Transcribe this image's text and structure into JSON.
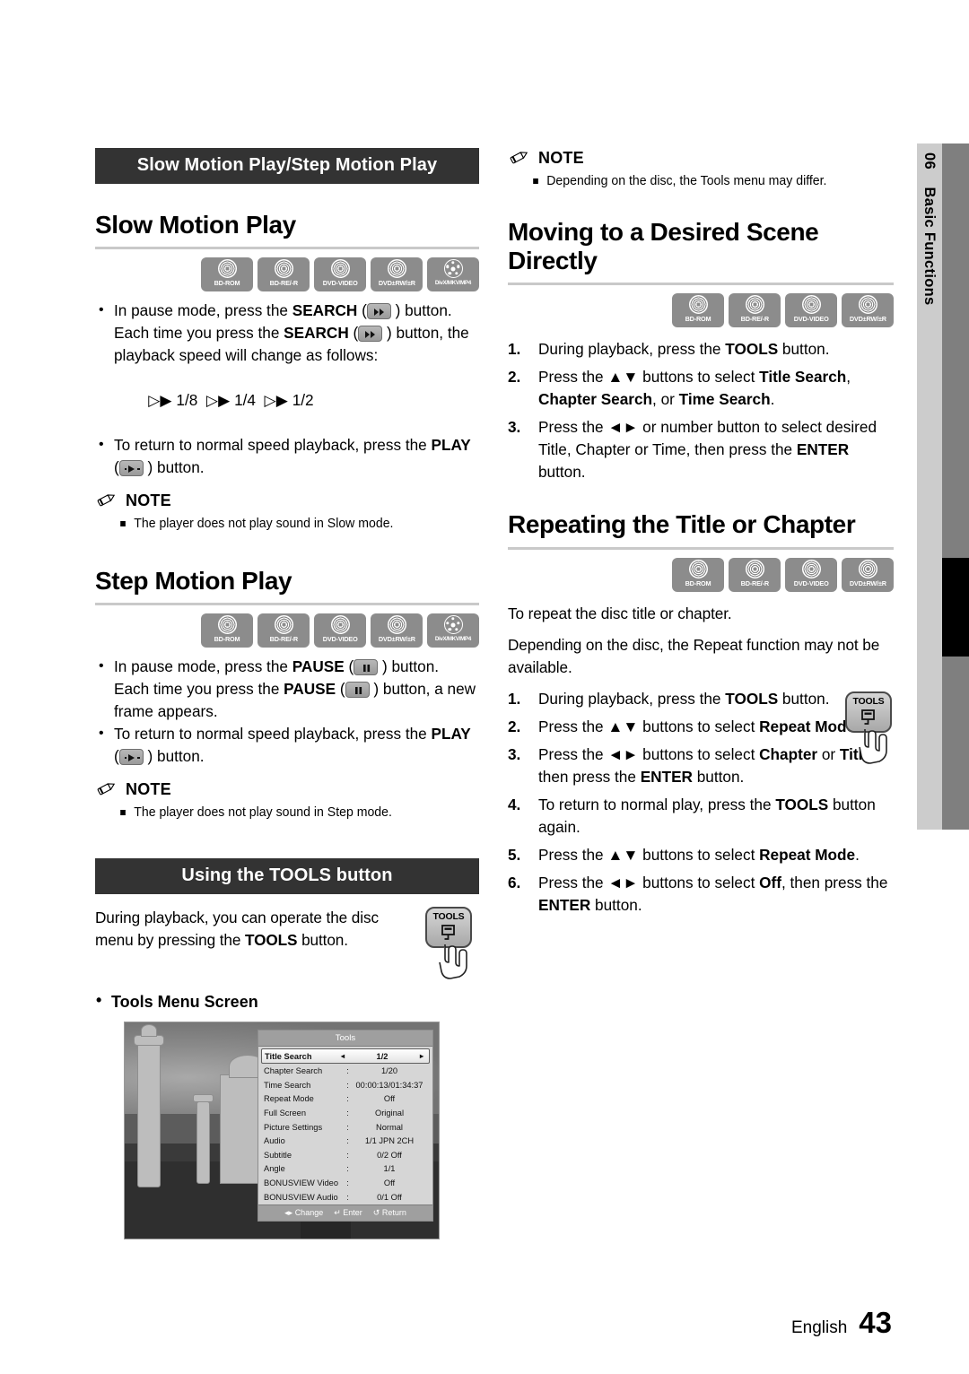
{
  "page": {
    "chapter_number": "06",
    "chapter_title": "Basic Functions",
    "footer_language": "English",
    "footer_page": "43"
  },
  "left_column": {
    "section_bar_1": "Slow Motion Play/Step Motion Play",
    "heading_slow": "Slow Motion Play",
    "discs_slow": [
      {
        "label": "BD-ROM",
        "type": "disc"
      },
      {
        "label": "BD-RE/-R",
        "type": "disc"
      },
      {
        "label": "DVD-VIDEO",
        "type": "disc"
      },
      {
        "label": "DVD±RW/±R",
        "type": "disc"
      },
      {
        "label": "DivX/MKV/MP4",
        "type": "divx"
      }
    ],
    "slow_bullet_1_a": "In pause mode, press the ",
    "slow_bullet_1_search": "SEARCH",
    "slow_bullet_1_b": " ) button.",
    "slow_cont_a": "Each time you press the ",
    "slow_cont_search": "SEARCH",
    "slow_cont_b": " ) button, the playback speed will change as follows:",
    "slow_speeds": "1/8      1/4      1/2",
    "slow_bullet_2_a": "To return to normal speed playback, press the ",
    "slow_bullet_2_play": "PLAY",
    "slow_bullet_2_b": " ) button.",
    "note_label_1": "NOTE",
    "note_items_1": [
      "The player does not play sound in Slow mode."
    ],
    "heading_step": "Step Motion Play",
    "discs_step": [
      {
        "label": "BD-ROM",
        "type": "disc"
      },
      {
        "label": "BD-RE/-R",
        "type": "disc"
      },
      {
        "label": "DVD-VIDEO",
        "type": "disc"
      },
      {
        "label": "DVD±RW/±R",
        "type": "disc"
      },
      {
        "label": "DivX/MKV/MP4",
        "type": "divx"
      }
    ],
    "step_bullet_1_a": "In pause mode, press the ",
    "step_bullet_1_pause": "PAUSE",
    "step_bullet_1_b": " ) button.",
    "step_cont_a": "Each time you press the ",
    "step_cont_pause": "PAUSE",
    "step_cont_b": " ) button, a new frame appears.",
    "step_bullet_2_a": "To return to normal speed playback, press the ",
    "step_bullet_2_play": "PLAY",
    "step_bullet_2_b": " ) button.",
    "note_label_2": "NOTE",
    "note_items_2": [
      "The player does not play sound in Step mode."
    ],
    "section_bar_2": "Using the TOOLS button",
    "tools_intro_a": "During playback, you can operate the disc menu by pressing the ",
    "tools_intro_tools": "TOOLS",
    "tools_intro_b": " button.",
    "tools_key_label": "TOOLS",
    "tools_menu_screen_label": "Tools Menu Screen"
  },
  "tools_menu": {
    "title": "Tools",
    "rows": [
      {
        "label": "Title Search",
        "colon": "",
        "value": "1/2",
        "selected": true
      },
      {
        "label": "Chapter Search",
        "colon": ":",
        "value": "1/20",
        "selected": false
      },
      {
        "label": "Time Search",
        "colon": ":",
        "value": "00:00:13/01:34:37",
        "selected": false
      },
      {
        "label": "Repeat Mode",
        "colon": ":",
        "value": "Off",
        "selected": false
      },
      {
        "label": "Full Screen",
        "colon": ":",
        "value": "Original",
        "selected": false
      },
      {
        "label": "Picture Settings",
        "colon": ":",
        "value": "Normal",
        "selected": false
      },
      {
        "label": "Audio",
        "colon": ":",
        "value": "1/1 JPN 2CH",
        "selected": false
      },
      {
        "label": "Subtitle",
        "colon": ":",
        "value": "0/2 Off",
        "selected": false
      },
      {
        "label": "Angle",
        "colon": ":",
        "value": "1/1",
        "selected": false
      },
      {
        "label": "BONUSVIEW Video",
        "colon": ":",
        "value": "Off",
        "selected": false
      },
      {
        "label": "BONUSVIEW Audio",
        "colon": ":",
        "value": "0/1 Off",
        "selected": false
      }
    ],
    "footer": [
      {
        "icon": "◂▸",
        "label": "Change"
      },
      {
        "icon": "↵",
        "label": "Enter"
      },
      {
        "icon": "↺",
        "label": "Return"
      }
    ]
  },
  "right_column": {
    "note_label_top": "NOTE",
    "note_items_top": [
      "Depending on the disc, the Tools menu may differ."
    ],
    "heading_moving": "Moving to a Desired Scene Directly",
    "discs_moving": [
      {
        "label": "BD-ROM",
        "type": "disc"
      },
      {
        "label": "BD-RE/-R",
        "type": "disc"
      },
      {
        "label": "DVD-VIDEO",
        "type": "disc"
      },
      {
        "label": "DVD±RW/±R",
        "type": "disc"
      }
    ],
    "moving_steps": [
      {
        "n": "1.",
        "parts": [
          {
            "t": "During playback, press the ",
            "b": false
          },
          {
            "t": "TOOLS",
            "b": true
          },
          {
            "t": " button.",
            "b": false
          }
        ]
      },
      {
        "n": "2.",
        "parts": [
          {
            "t": "Press the ▲▼ buttons to select ",
            "b": false
          },
          {
            "t": "Title Search",
            "b": true
          },
          {
            "t": ", ",
            "b": false
          },
          {
            "t": "Chapter Search",
            "b": true
          },
          {
            "t": ", or ",
            "b": false
          },
          {
            "t": "Time Search",
            "b": true
          },
          {
            "t": ".",
            "b": false
          }
        ]
      },
      {
        "n": "3.",
        "parts": [
          {
            "t": "Press the ◄► or number button to select desired Title, Chapter or Time, then press the ",
            "b": false
          },
          {
            "t": "ENTER",
            "b": true
          },
          {
            "t": " button.",
            "b": false
          }
        ]
      }
    ],
    "heading_repeating": "Repeating the Title or Chapter",
    "discs_repeating": [
      {
        "label": "BD-ROM",
        "type": "disc"
      },
      {
        "label": "BD-RE/-R",
        "type": "disc"
      },
      {
        "label": "DVD-VIDEO",
        "type": "disc"
      },
      {
        "label": "DVD±RW/±R",
        "type": "disc"
      }
    ],
    "repeat_intro_1": "To repeat the disc title or chapter.",
    "repeat_intro_2": "Depending on the disc, the Repeat function may not be available.",
    "tools_key_label": "TOOLS",
    "repeat_steps": [
      {
        "n": "1.",
        "parts": [
          {
            "t": "During playback, press the ",
            "b": false
          },
          {
            "t": "TOOLS",
            "b": true
          },
          {
            "t": " button.",
            "b": false
          }
        ]
      },
      {
        "n": "2.",
        "parts": [
          {
            "t": "Press the ▲▼ buttons to select ",
            "b": false
          },
          {
            "t": "Repeat Mode",
            "b": true
          },
          {
            "t": ".",
            "b": false
          }
        ]
      },
      {
        "n": "3.",
        "parts": [
          {
            "t": "Press the ◄► buttons to select ",
            "b": false
          },
          {
            "t": "Chapter",
            "b": true
          },
          {
            "t": " or ",
            "b": false
          },
          {
            "t": "Title",
            "b": true
          },
          {
            "t": ", then press the ",
            "b": false
          },
          {
            "t": "ENTER",
            "b": true
          },
          {
            "t": " button.",
            "b": false
          }
        ]
      },
      {
        "n": "4.",
        "parts": [
          {
            "t": "To return to normal play, press the ",
            "b": false
          },
          {
            "t": "TOOLS",
            "b": true
          },
          {
            "t": " button again.",
            "b": false
          }
        ]
      },
      {
        "n": "5.",
        "parts": [
          {
            "t": "Press the ▲▼ buttons to select ",
            "b": false
          },
          {
            "t": "Repeat Mode",
            "b": true
          },
          {
            "t": ".",
            "b": false
          }
        ]
      },
      {
        "n": "6.",
        "parts": [
          {
            "t": "Press the ◄► buttons to select ",
            "b": false
          },
          {
            "t": "Off",
            "b": true
          },
          {
            "t": ", then press the ",
            "b": false
          },
          {
            "t": "ENTER",
            "b": true
          },
          {
            "t": " button.",
            "b": false
          }
        ]
      }
    ]
  }
}
